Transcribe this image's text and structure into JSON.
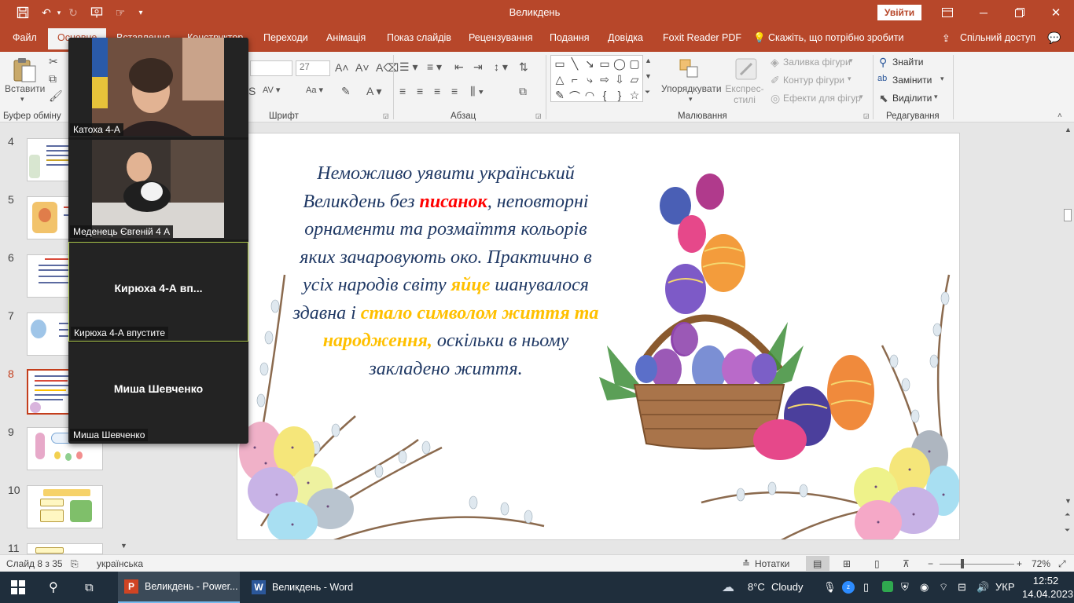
{
  "window": {
    "title": "Великдень",
    "sign_in": "Увійти"
  },
  "colors": {
    "accent": "#b7472a",
    "slide_text": "#1f3864",
    "highlight_red": "#ff0000",
    "highlight_gold": "#ffc000",
    "zoom_speaker_border": "#a8c448"
  },
  "tabs": [
    {
      "label": "Файл"
    },
    {
      "label": "Основне"
    },
    {
      "label": "Вставлення"
    },
    {
      "label": "Конструктор"
    },
    {
      "label": "Переходи"
    },
    {
      "label": "Анімація"
    },
    {
      "label": "Показ слайдів"
    },
    {
      "label": "Рецензування"
    },
    {
      "label": "Подання"
    },
    {
      "label": "Довідка"
    },
    {
      "label": "Foxit Reader PDF"
    },
    {
      "label": "Скажіть, що потрібно зробити"
    },
    {
      "label": "Спільний доступ"
    }
  ],
  "ribbon": {
    "paste_label": "Вставити",
    "groups": {
      "clipboard": "Буфер обміну",
      "font": "Шрифт",
      "paragraph": "Абзац",
      "drawing": "Малювання",
      "editing": "Редагування"
    },
    "font_size": "27",
    "arrange_label": "Упорядкувати",
    "quick_styles_label": "Експрес-стилі",
    "shape_fill": "Заливка фігури",
    "shape_outline": "Контур фігури",
    "shape_effects": "Ефекти для фігур",
    "find": "Знайти",
    "replace": "Замінити",
    "select": "Виділити"
  },
  "thumbnails": [
    {
      "num": "4"
    },
    {
      "num": "5"
    },
    {
      "num": "6"
    },
    {
      "num": "7"
    },
    {
      "num": "8"
    },
    {
      "num": "9"
    },
    {
      "num": "10"
    },
    {
      "num": "11"
    }
  ],
  "slide": {
    "t1": "Неможливо уявити український Великдень без ",
    "t2": "писанок",
    "t3": ", неповторні орнаменти та розмаїття кольорів яких зачаровують око. Практично в усіх народів світу ",
    "t4": "яйце",
    "t5": " шанувалося здавна і ",
    "t6": "стало символом життя та народження,",
    "t7": " оскільки в ньому закладено життя."
  },
  "zoom": {
    "participants": [
      {
        "name": "Катоха 4-А",
        "center": ""
      },
      {
        "name": "Меденець Євгеній 4 А",
        "center": ""
      },
      {
        "name": "Кирюха 4-А впустите",
        "center": "Кирюха 4-А вп..."
      },
      {
        "name": "Миша Шевченко",
        "center": "Миша Шевченко"
      }
    ]
  },
  "status": {
    "slide": "Слайд 8 з 35",
    "language": "українська",
    "notes": "Нотатки",
    "zoom": "72%"
  },
  "taskbar": {
    "apps": [
      {
        "label": "Великдень - Power..."
      },
      {
        "label": "Великдень - Word"
      }
    ],
    "weather_temp": "8°C",
    "weather_desc": "Cloudy",
    "lang": "УКР",
    "time": "12:52",
    "date": "14.04.2023"
  }
}
